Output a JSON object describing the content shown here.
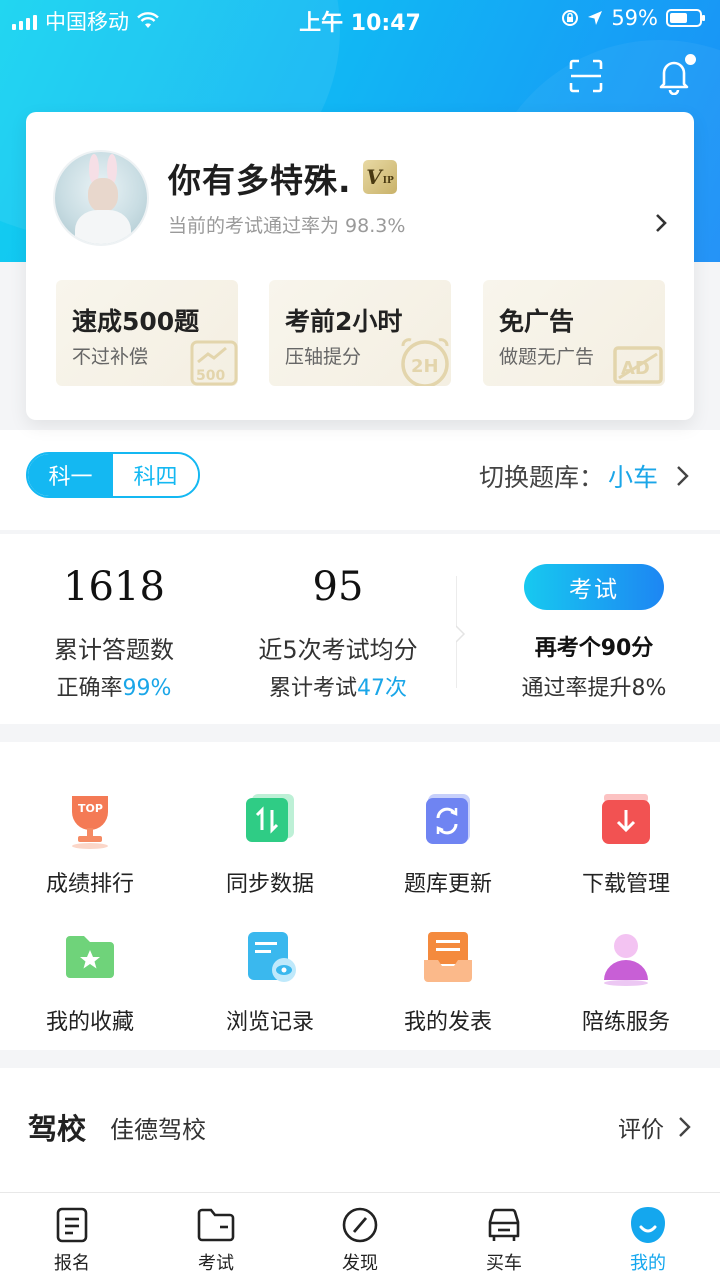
{
  "status_bar": {
    "carrier": "中国移动",
    "time": "上午 10:47",
    "battery": "59%",
    "battery_level": 0.59
  },
  "header": {
    "scan_icon": "scan-icon",
    "bell_icon": "bell-icon"
  },
  "profile": {
    "username": "你有多特殊.",
    "vip_label": "V",
    "vip_sub": "IP",
    "pass_rate_text": "当前的考试通过率为 98.3%",
    "perks": [
      {
        "title": "速成500题",
        "sub": "不过补偿",
        "mark": "500"
      },
      {
        "title": "考前2小时",
        "sub": "压轴提分",
        "mark": "2H"
      },
      {
        "title": "免广告",
        "sub": "做题无广告",
        "mark": "AD"
      }
    ]
  },
  "subject": {
    "tab1": "科一",
    "tab2": "科四",
    "switch_label": "切换题库：",
    "switch_value": "小车"
  },
  "stats": {
    "answered_count": "1618",
    "answered_label": "累计答题数",
    "accuracy_prefix": "正确率",
    "accuracy_value": "99%",
    "avg_score": "95",
    "avg_label": "近5次考试均分",
    "exam_count_prefix": "累计考试",
    "exam_count_value": "47次",
    "exam_button": "考试",
    "retake_text": "再考个90分",
    "boost_text": "通过率提升8%"
  },
  "tools": [
    {
      "label": "成绩排行",
      "icon": "trophy-icon"
    },
    {
      "label": "同步数据",
      "icon": "sync-icon"
    },
    {
      "label": "题库更新",
      "icon": "refresh-icon"
    },
    {
      "label": "下载管理",
      "icon": "download-icon"
    },
    {
      "label": "我的收藏",
      "icon": "star-folder-icon"
    },
    {
      "label": "浏览记录",
      "icon": "history-icon"
    },
    {
      "label": "我的发表",
      "icon": "tray-icon"
    },
    {
      "label": "陪练服务",
      "icon": "coach-icon"
    }
  ],
  "tool_badge_top": "TOP",
  "school": {
    "heading": "驾校",
    "name": "佳德驾校",
    "review": "评价"
  },
  "tabbar": [
    {
      "label": "报名",
      "icon": "signup-icon"
    },
    {
      "label": "考试",
      "icon": "exam-folder-icon"
    },
    {
      "label": "发现",
      "icon": "compass-icon"
    },
    {
      "label": "买车",
      "icon": "car-icon"
    },
    {
      "label": "我的",
      "icon": "me-icon"
    }
  ],
  "colors": {
    "accent": "#14b8f2",
    "highlight": "#1aa6e8"
  }
}
